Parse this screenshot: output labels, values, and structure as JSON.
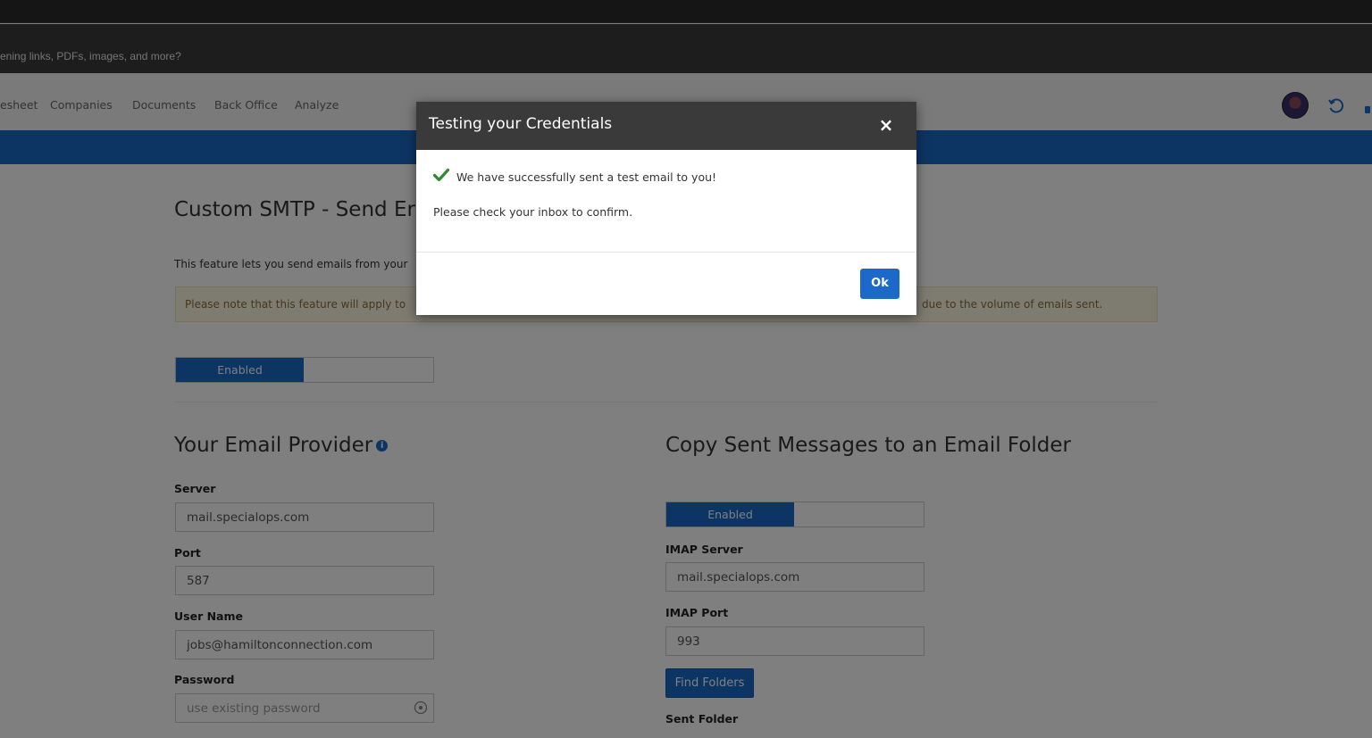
{
  "browser": {
    "infobar_text": "ening links, PDFs, images, and more?"
  },
  "nav": {
    "items": [
      "esheet",
      "Companies",
      "Documents",
      "Back Office",
      "Analyze"
    ]
  },
  "page": {
    "title": "Custom SMTP - Send Er",
    "intro": "This feature lets you send emails from your",
    "note_left": "Please note that this feature will apply to",
    "note_right": "due to the volume of emails sent.",
    "main_toggle": {
      "on_label": "Enabled"
    }
  },
  "provider": {
    "title": "Your Email Provider",
    "info_icon": "i",
    "server_label": "Server",
    "server_value": "mail.specialops.com",
    "port_label": "Port",
    "port_value": "587",
    "username_label": "User Name",
    "username_value": "jobs@hamiltonconnection.com",
    "password_label": "Password",
    "password_placeholder": "use existing password"
  },
  "copy_sent": {
    "title": "Copy Sent Messages to an Email Folder",
    "toggle_on_label": "Enabled",
    "imap_server_label": "IMAP Server",
    "imap_server_value": "mail.specialops.com",
    "imap_port_label": "IMAP Port",
    "imap_port_value": "993",
    "find_folders_label": "Find Folders",
    "sent_folder_label": "Sent Folder"
  },
  "modal": {
    "title": "Testing your Credentials",
    "close_symbol": "×",
    "success_message": "We have successfully sent a test email to you!",
    "confirm_message": "Please check your inbox to confirm.",
    "ok_label": "Ok"
  },
  "colors": {
    "accent": "#1b6ac9",
    "modal_header": "#3a3a3a",
    "success_check": "#2e8b2e"
  }
}
